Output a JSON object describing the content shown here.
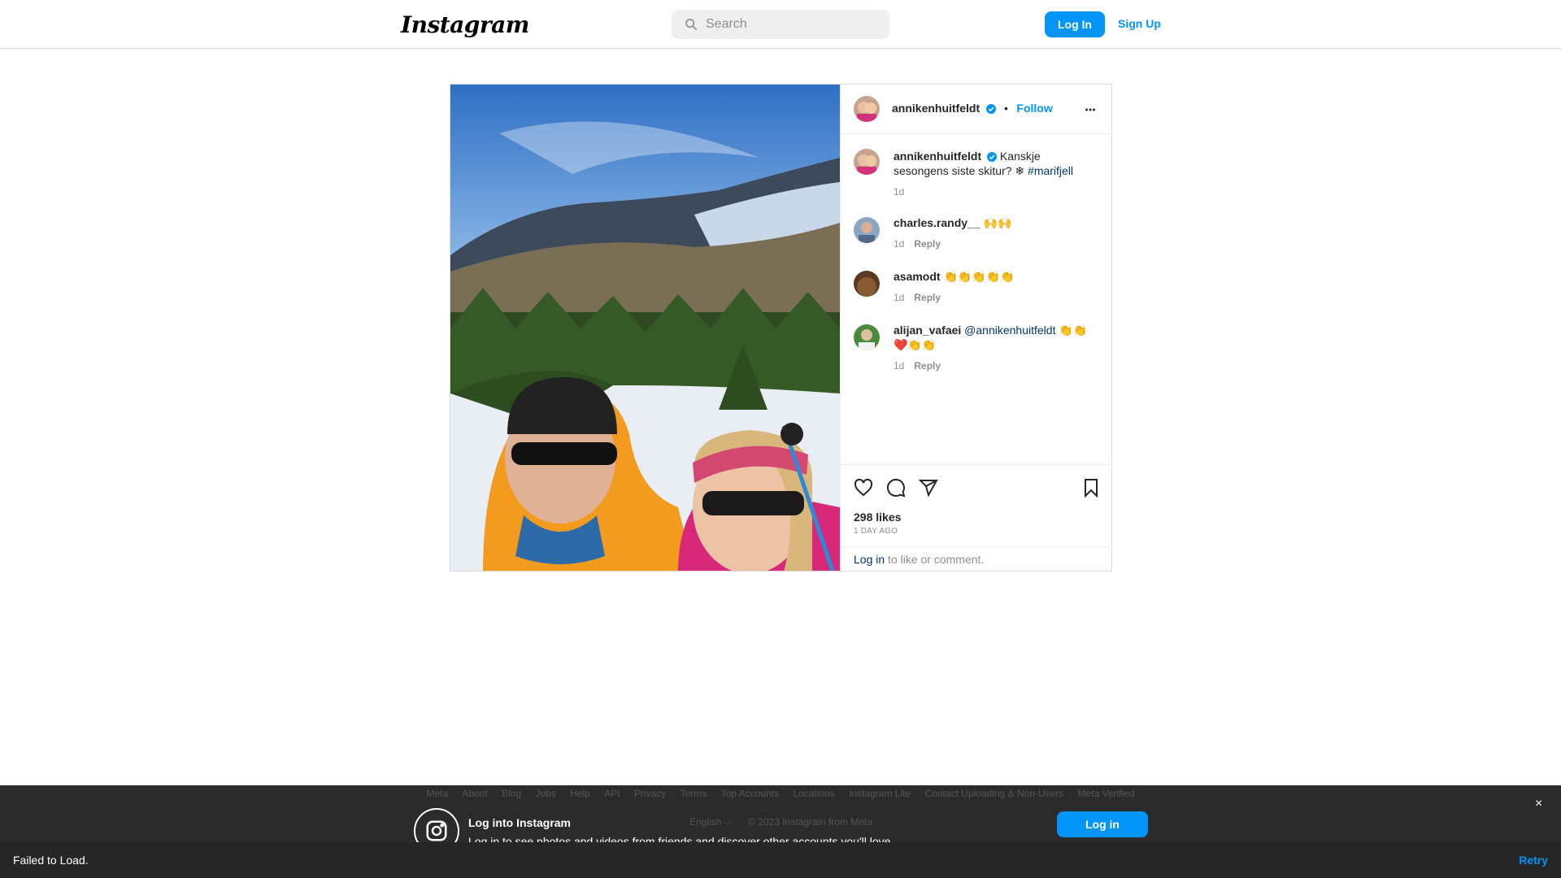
{
  "topbar": {
    "logo": "Instagram",
    "search_placeholder": "Search",
    "login_label": "Log In",
    "signup_label": "Sign Up"
  },
  "post": {
    "author": "annikenhuitfeldt",
    "follow_label": "Follow",
    "separator": "•",
    "caption": {
      "user": "annikenhuitfeldt",
      "text": "Kanskje sesongens siste skitur? ❄ ",
      "hashtag": "#marifjell",
      "time": "1d"
    },
    "comments": [
      {
        "user": "charles.randy__",
        "text": "🙌🙌",
        "time": "1d",
        "reply": "Reply"
      },
      {
        "user": "asamodt",
        "text": "👏👏👏👏👏",
        "time": "1d",
        "reply": "Reply"
      },
      {
        "user": "alijan_vafaei",
        "mention": "@annikenhuitfeldt",
        "text": " 👏👏❤️👏👏",
        "time": "1d",
        "reply": "Reply"
      }
    ],
    "likes": "298 likes",
    "posted_ago": "1 DAY AGO",
    "login_link": "Log in",
    "login_prompt": " to like or comment."
  },
  "banner": {
    "footer_links": [
      "Meta",
      "About",
      "Blog",
      "Jobs",
      "Help",
      "API",
      "Privacy",
      "Terms",
      "Top Accounts",
      "Locations",
      "Instagram Lite",
      "Contact Uploading & Non-Users",
      "Meta Verified"
    ],
    "title": "Log into Instagram",
    "subtitle": "Log in to see photos and videos from friends and discover other accounts you'll love.",
    "language": "English ⌵",
    "copyright": "© 2023 Instagram from Meta",
    "login_label": "Log in",
    "close_label": "×"
  },
  "toast": {
    "message": "Failed to Load.",
    "retry_label": "Retry"
  },
  "colors": {
    "accent": "#0095f6",
    "link": "#00376b",
    "banner_bg": "#2b2b2b",
    "toast_bg": "#262626"
  },
  "icons": [
    "search-icon",
    "verified-badge-icon",
    "more-options-icon",
    "heart-icon",
    "comment-icon",
    "share-icon",
    "bookmark-icon",
    "instagram-icon"
  ]
}
